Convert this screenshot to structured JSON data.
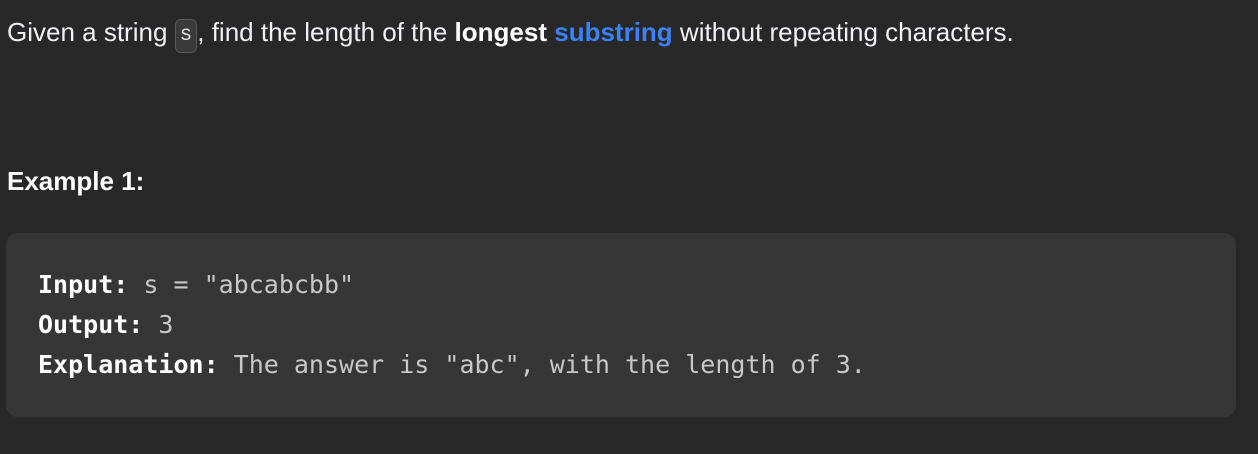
{
  "problem": {
    "text_before_code": "Given a string ",
    "code_var": "s",
    "text_after_code": ", find the length of the ",
    "bold_word": "longest",
    "space": " ",
    "link_word": "substring",
    "text_end": " without repeating characters."
  },
  "example": {
    "title": "Example 1:",
    "lines": [
      {
        "label": "Input:",
        "value": " s = \"abcabcbb\""
      },
      {
        "label": "Output:",
        "value": " 3"
      },
      {
        "label": "Explanation:",
        "value": " The answer is \"abc\", with the length of 3."
      }
    ]
  }
}
